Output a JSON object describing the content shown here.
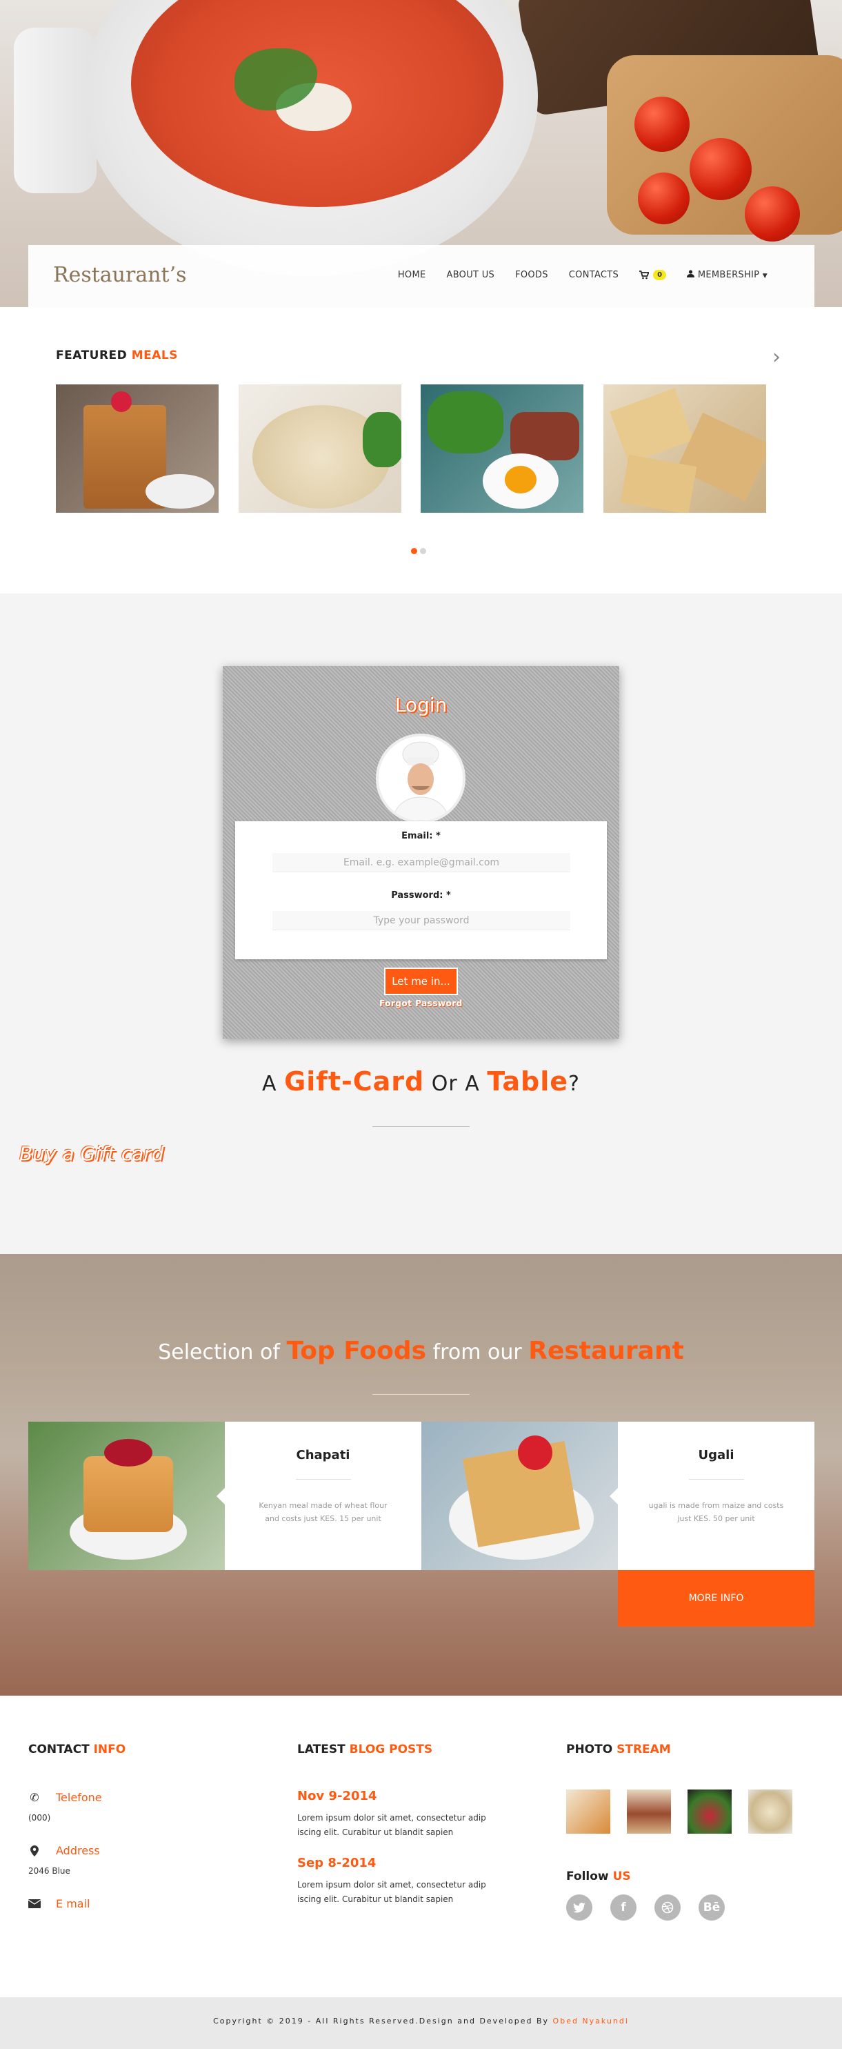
{
  "brand": "Restaurant’s",
  "nav": {
    "items": [
      "HOME",
      "ABOUT US",
      "FOODS",
      "CONTACTS"
    ],
    "cart_count": "0",
    "membership": "MEMBERSHIP",
    "cart_icon": "shopping-cart-icon",
    "user_icon": "user-icon"
  },
  "featured": {
    "title_a": "FEATURED",
    "title_b": "MEALS",
    "next_icon": "chevron-right-icon"
  },
  "login": {
    "title": "Login",
    "email_label": "Email: *",
    "email_placeholder": "Email. e.g. example@gmail.com",
    "password_label": "Password: *",
    "password_placeholder": "Type your password",
    "button": "Let me in...",
    "forgot": "Forgot Password"
  },
  "gift": {
    "a1": "A",
    "word1": "Gift-Card",
    "mid": "Or A",
    "word2": "Table",
    "q": "?",
    "buy": "Buy a Gift card"
  },
  "top_foods": {
    "pre": "Selection of",
    "word1": "Top Foods",
    "mid": "from our",
    "word2": "Restaurant",
    "cards": [
      {
        "name": "Chapati",
        "desc": "Kenyan meal made of wheat flour and costs just KES. 15 per unit"
      },
      {
        "name": "Ugali",
        "desc": "ugali is made from maize and costs just KES. 50 per unit"
      }
    ],
    "more_info": "MORE INFO"
  },
  "footer": {
    "contact_a": "CONTACT",
    "contact_b": "INFO",
    "phone_label": "Telefone",
    "phone_value": "(000)",
    "address_label": "Address",
    "address_value": "2046 Blue",
    "email_label": "E mail",
    "blog_a": "LATEST",
    "blog_b": "BLOG POSTS",
    "posts": [
      {
        "date": "Nov 9-2014",
        "text": "Lorem ipsum dolor sit amet, consectetur adip iscing elit. Curabitur ut blandit sapien"
      },
      {
        "date": "Sep 8-2014",
        "text": "Lorem ipsum dolor sit amet, consectetur adip iscing elit. Curabitur ut blandit sapien"
      }
    ],
    "photo_a": "PHOTO",
    "photo_b": "STREAM",
    "follow_a": "Follow",
    "follow_b": "US",
    "social": [
      "twitter-icon",
      "facebook-icon",
      "dribbble-icon",
      "behance-icon"
    ],
    "copyright": "Copyright © 2019 - All Rights Reserved.Design and Developed By",
    "author": "Obed Nyakundi"
  },
  "colors": {
    "accent": "#fe5a12",
    "badge": "#f6e81b"
  }
}
